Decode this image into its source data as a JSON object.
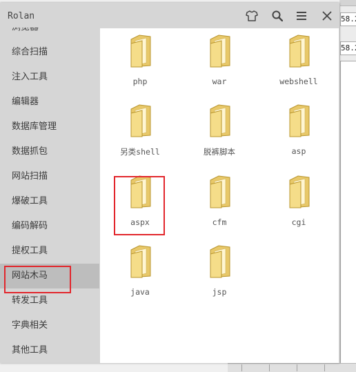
{
  "background": {
    "field1_text": "58.2",
    "field2_text": "58.2"
  },
  "window": {
    "title": "Rolan",
    "controls": [
      "shirt-icon",
      "search-icon",
      "menu-icon",
      "close-icon"
    ]
  },
  "sidebar": {
    "items": [
      {
        "label": "浏览器"
      },
      {
        "label": "综合扫描"
      },
      {
        "label": "注入工具"
      },
      {
        "label": "编辑器"
      },
      {
        "label": "数据库管理"
      },
      {
        "label": "数据抓包"
      },
      {
        "label": "网站扫描"
      },
      {
        "label": "爆破工具"
      },
      {
        "label": "编码解码"
      },
      {
        "label": "提权工具"
      },
      {
        "label": "网站木马"
      },
      {
        "label": "转发工具"
      },
      {
        "label": "字典相关"
      },
      {
        "label": "其他工具"
      }
    ],
    "active_label": "网站木马"
  },
  "folders": [
    {
      "label": "php"
    },
    {
      "label": "war"
    },
    {
      "label": "webshell"
    },
    {
      "label": "另类shell"
    },
    {
      "label": "脱裤脚本"
    },
    {
      "label": "asp"
    },
    {
      "label": "aspx"
    },
    {
      "label": "cfm"
    },
    {
      "label": "cgi"
    },
    {
      "label": "java"
    },
    {
      "label": "jsp"
    }
  ],
  "highlight_color": "#e2252b"
}
